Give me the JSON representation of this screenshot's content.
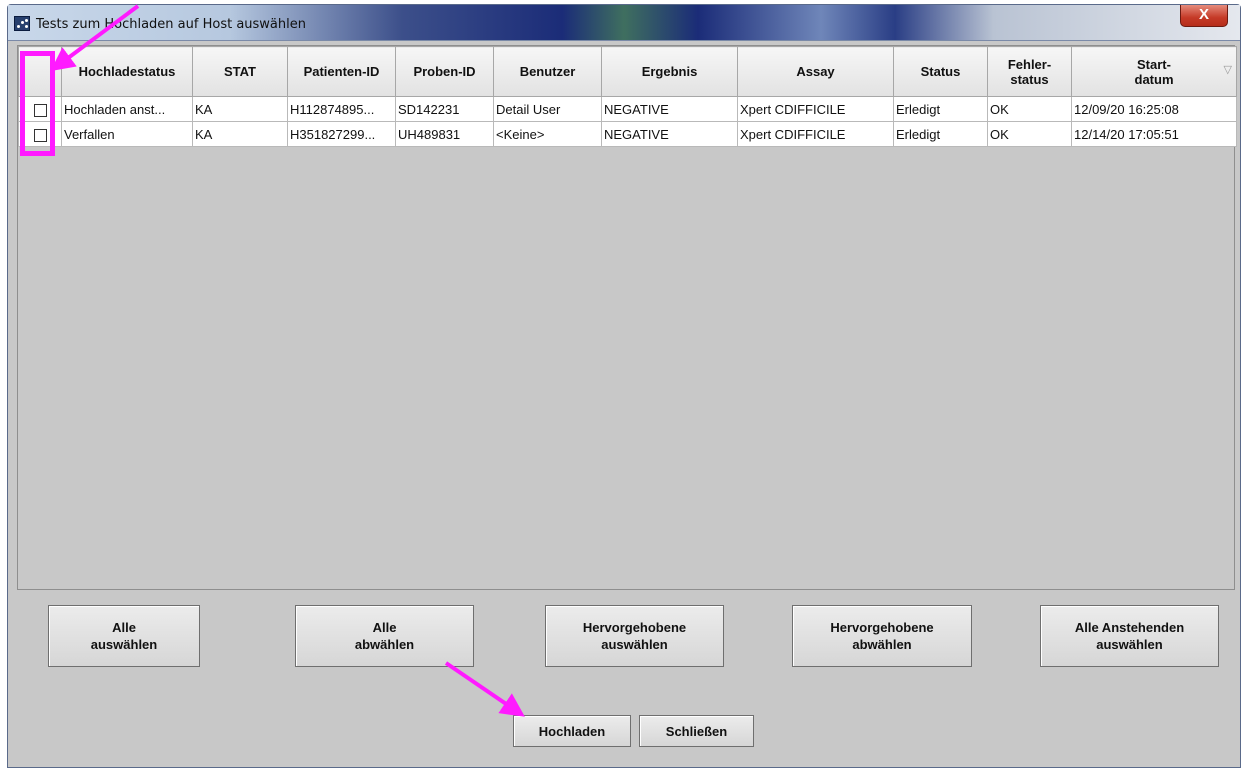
{
  "window": {
    "title": "Tests zum Hochladen auf Host auswählen",
    "close_label": "X"
  },
  "table": {
    "columns": [
      "",
      "Hochladestatus",
      "STAT",
      "Patienten-ID",
      "Proben-ID",
      "Benutzer",
      "Ergebnis",
      "Assay",
      "Status",
      "Fehler-\nstatus",
      "Start-\ndatum"
    ],
    "rows": [
      {
        "hochladestatus": "Hochladen anst...",
        "stat": "KA",
        "patienten_id": "H112874895...",
        "proben_id": "SD142231",
        "benutzer": "Detail User",
        "ergebnis": "NEGATIVE",
        "assay": "Xpert CDIFFICILE",
        "status": "Erledigt",
        "fehlerstatus": "OK",
        "startdatum": "12/09/20 16:25:08"
      },
      {
        "hochladestatus": "Verfallen",
        "stat": "KA",
        "patienten_id": "H351827299...",
        "proben_id": "UH489831",
        "benutzer": "<Keine>",
        "ergebnis": "NEGATIVE",
        "assay": "Xpert CDIFFICILE",
        "status": "Erledigt",
        "fehlerstatus": "OK",
        "startdatum": "12/14/20 17:05:51"
      }
    ],
    "sort_indicator": "▽"
  },
  "buttons": {
    "select_all": "Alle\nauswählen",
    "deselect_all": "Alle\nabwählen",
    "select_highlighted": "Hervorgehobene\nauswählen",
    "deselect_highlighted": "Hervorgehobene\nabwählen",
    "select_all_pending": "Alle Anstehenden\nauswählen",
    "upload": "Hochladen",
    "close": "Schließen"
  },
  "colors": {
    "annotation": "#ff1aff",
    "window_bg": "#c8c8c8"
  }
}
